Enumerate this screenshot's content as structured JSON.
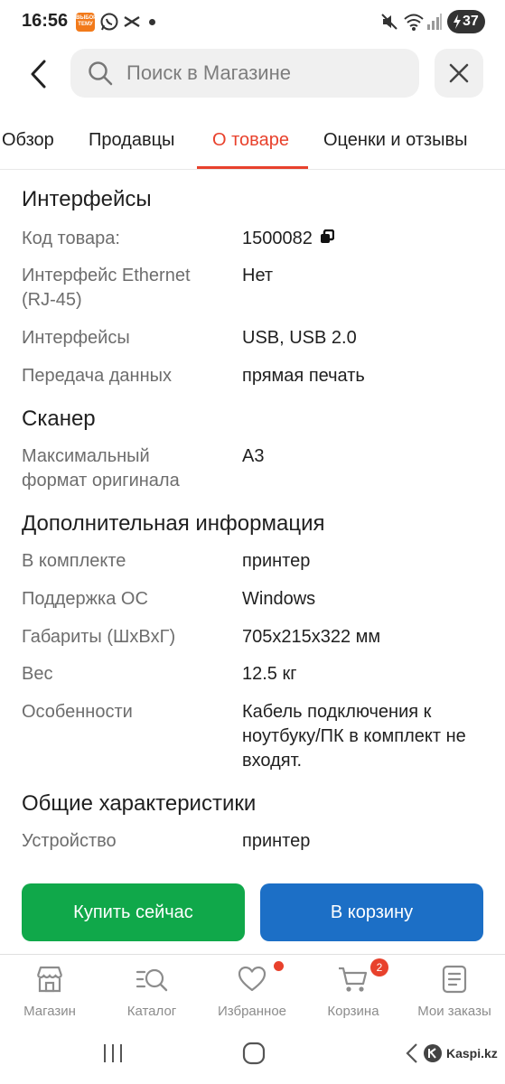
{
  "status_bar": {
    "time": "16:56",
    "battery": "37",
    "temu_label": "ВЫБОР ТЕМУ"
  },
  "search": {
    "placeholder": "Поиск в Магазине"
  },
  "tabs": [
    {
      "label": "Обзор",
      "active": false
    },
    {
      "label": "Продавцы",
      "active": false
    },
    {
      "label": "О товаре",
      "active": true
    },
    {
      "label": "Оценки и отзывы",
      "active": false
    }
  ],
  "sections": {
    "interfaces": {
      "title": "Интерфейсы",
      "rows": [
        {
          "label": "Код товара:",
          "value": "1500082"
        },
        {
          "label": "Интерфейс Ethernet (RJ-45)",
          "value": "Нет"
        },
        {
          "label": "Интерфейсы",
          "value": "USB, USB 2.0"
        },
        {
          "label": "Передача данных",
          "value": "прямая печать"
        }
      ]
    },
    "scanner": {
      "title": "Сканер",
      "rows": [
        {
          "label": "Максимальный формат оригинала",
          "value": "A3"
        }
      ]
    },
    "additional": {
      "title": "Дополнительная информация",
      "rows": [
        {
          "label": "В комплекте",
          "value": "принтер"
        },
        {
          "label": "Поддержка ОС",
          "value": "Windows"
        },
        {
          "label": "Габариты (ШxВxГ)",
          "value": "705x215x322 мм"
        },
        {
          "label": "Вес",
          "value": "12.5 кг"
        },
        {
          "label": "Особенности",
          "value": "Кабель подключения к ноутбуку/ПК в комплект не входят."
        }
      ]
    },
    "general": {
      "title": "Общие характеристики",
      "rows": [
        {
          "label": "Устройство",
          "value": "принтер"
        }
      ]
    }
  },
  "actions": {
    "buy_label": "Купить сейчас",
    "cart_label": "В корзину"
  },
  "bottom_nav": [
    {
      "label": "Магазин",
      "icon": "store-icon"
    },
    {
      "label": "Каталог",
      "icon": "catalog-search-icon"
    },
    {
      "label": "Избранное",
      "icon": "heart-icon"
    },
    {
      "label": "Корзина",
      "icon": "cart-icon",
      "badge": "2"
    },
    {
      "label": "Мои заказы",
      "icon": "orders-icon"
    }
  ],
  "watermark": "Kaspi.kz",
  "colors": {
    "accent": "#e8412c",
    "buy": "#10a84a",
    "cart": "#1c6fc6"
  }
}
